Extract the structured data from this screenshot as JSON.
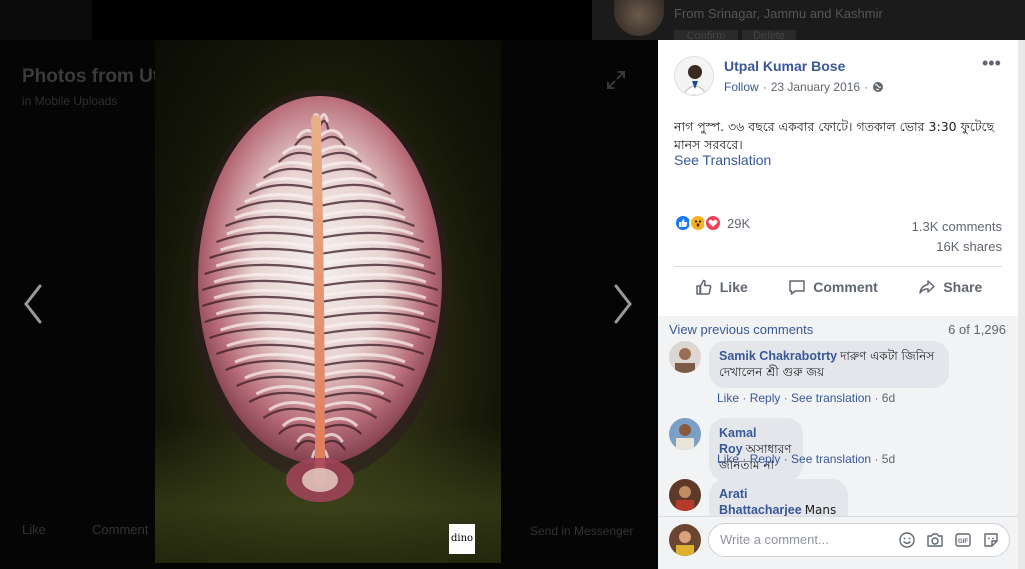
{
  "background": {
    "from_text": "From Srinagar, Jammu and Kashmir",
    "confirm_label": "Confirm",
    "delete_label": "Delete"
  },
  "theater": {
    "title": "Photos from Utpal Kumar Bose's post",
    "subtitle": "in Mobile Uploads",
    "footer_like": "Like",
    "footer_comment": "Comment",
    "footer_messenger": "Send in Messenger",
    "watermark": "dino"
  },
  "post": {
    "author": "Utpal Kumar Bose",
    "follow": "Follow",
    "date": "23 January 2016",
    "text": "নাগ পুস্প. ৩৬ বছরে একবার ফোটে। গতকাল ভোর 3:30 ফুটেছে মানস সরবরে।",
    "see_translation": "See Translation",
    "reaction_count": "29K",
    "comments_count": "1.3K comments",
    "shares_count": "16K shares",
    "actions": {
      "like": "Like",
      "comment": "Comment",
      "share": "Share"
    }
  },
  "comments": {
    "view_previous": "View previous comments",
    "count_of": "6 of 1,296",
    "items": [
      {
        "name": "Samik Chakrabotrty",
        "text": "দারুণ একটা জিনিস দেখালেন শ্রী গুরু জয়",
        "like": "Like",
        "reply": "Reply",
        "see_translation": "See translation",
        "time": "6d"
      },
      {
        "name": "Kamal Roy",
        "text": "অসাধারণ জানতাম না",
        "like": "Like",
        "reply": "Reply",
        "see_translation": "See translation",
        "time": "5d"
      },
      {
        "name": "Arati Bhattacharjee",
        "text": "Mans srobrta kothay ?"
      }
    ],
    "compose_placeholder": "Write a comment..."
  },
  "colors": {
    "link": "#385898",
    "like_blue": "#1877f2",
    "love_red": "#f33e58",
    "wow_yellow": "#f7b125"
  }
}
